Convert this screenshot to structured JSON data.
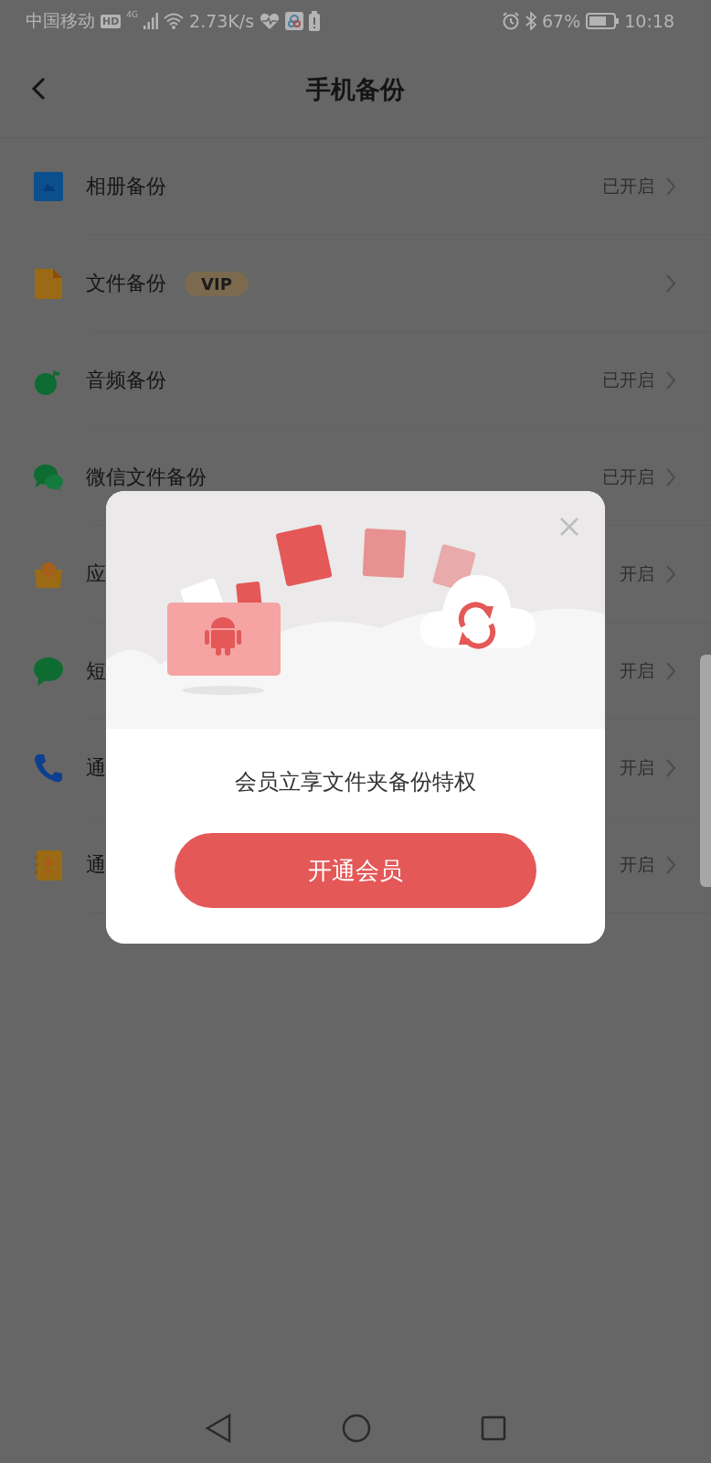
{
  "status_bar": {
    "carrier": "中国移动",
    "hd": "HD",
    "network": "4G",
    "speed": "2.73K/s",
    "battery": "67%",
    "time": "10:18"
  },
  "header": {
    "title": "手机备份"
  },
  "backup_items": [
    {
      "kind": "photo",
      "label": "相册备份",
      "status": "已开启"
    },
    {
      "kind": "file",
      "label": "文件备份",
      "badge": "VIP"
    },
    {
      "kind": "music",
      "label": "音频备份",
      "status": "已开启"
    },
    {
      "kind": "wechat",
      "label": "微信文件备份",
      "status": "已开启"
    },
    {
      "kind": "app",
      "label": "应",
      "status": "开启"
    },
    {
      "kind": "sms",
      "label": "短",
      "status": "开启"
    },
    {
      "kind": "phone",
      "label": "通",
      "status": "开启"
    },
    {
      "kind": "contacts",
      "label": "通",
      "status": "开启"
    }
  ],
  "dialog": {
    "message": "会员立享文件夹备份特权",
    "button": "开通会员"
  }
}
